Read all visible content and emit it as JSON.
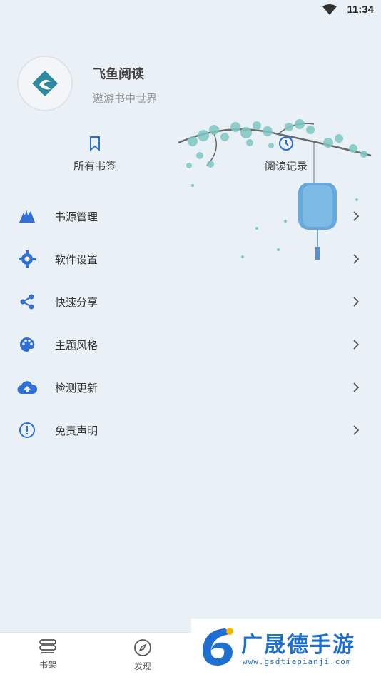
{
  "status_bar": {
    "time": "11:34"
  },
  "profile": {
    "app_name": "飞鱼阅读",
    "slogan": "遨游书中世界"
  },
  "quick_links": [
    {
      "label": "所有书签",
      "icon": "bookmark-icon"
    },
    {
      "label": "阅读记录",
      "icon": "clock-icon"
    }
  ],
  "menu": [
    {
      "label": "书源管理",
      "icon": "book-source-icon"
    },
    {
      "label": "软件设置",
      "icon": "gear-icon"
    },
    {
      "label": "快速分享",
      "icon": "share-icon"
    },
    {
      "label": "主题风格",
      "icon": "palette-icon"
    },
    {
      "label": "检测更新",
      "icon": "cloud-upload-icon"
    },
    {
      "label": "免责声明",
      "icon": "info-icon"
    }
  ],
  "bottom_nav": [
    {
      "label": "书架",
      "icon": "bookshelf-icon"
    },
    {
      "label": "发现",
      "icon": "compass-icon"
    }
  ],
  "watermark": {
    "brand": "广晟德手游",
    "url": "www.gsdtiepianji.com"
  },
  "colors": {
    "accent": "#2f6fd6",
    "background": "#eaf1f6",
    "watermark": "#1f6fd1"
  }
}
